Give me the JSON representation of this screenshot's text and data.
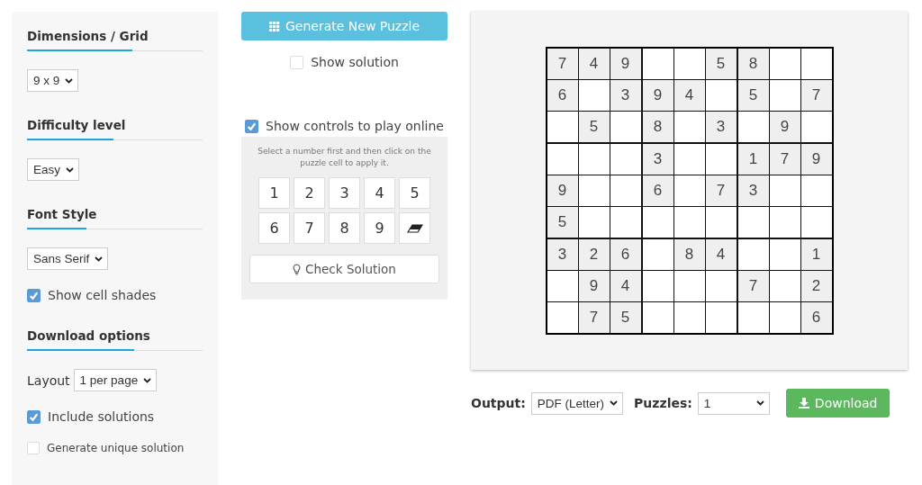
{
  "sidebar": {
    "sections": [
      {
        "title": "Dimensions / Grid",
        "controls": [
          {
            "kind": "select",
            "value": "9 x 9"
          }
        ]
      },
      {
        "title": "Difficulty level",
        "controls": [
          {
            "kind": "select",
            "value": "Easy"
          }
        ]
      },
      {
        "title": "Font Style",
        "controls": [
          {
            "kind": "select",
            "value": "Sans Serif"
          },
          {
            "kind": "checkbox",
            "label": "Show cell shades",
            "checked": true
          }
        ]
      },
      {
        "title": "Download options",
        "controls": [
          {
            "kind": "labeled-select",
            "label": "Layout",
            "value": "1 per page"
          },
          {
            "kind": "checkbox",
            "label": "Include solutions",
            "checked": true
          },
          {
            "kind": "small-checkbox",
            "label": "Generate unique solution",
            "checked": false
          }
        ]
      }
    ]
  },
  "generate_button": "Generate New Puzzle",
  "show_solution": {
    "label": "Show solution",
    "checked": false
  },
  "show_controls": {
    "label": "Show controls to play online",
    "checked": true
  },
  "controls_panel": {
    "hint": "Select a number first and then click on the puzzle cell to apply it.",
    "keys": [
      "1",
      "2",
      "3",
      "4",
      "5",
      "6",
      "7",
      "8",
      "9"
    ],
    "check_button": "Check Solution"
  },
  "puzzle": {
    "rows": [
      [
        "7",
        "4",
        "9",
        null,
        null,
        "5",
        "8",
        null,
        null
      ],
      [
        "6",
        null,
        "3",
        "9",
        "4",
        null,
        "5",
        null,
        "7"
      ],
      [
        null,
        "5",
        null,
        "8",
        null,
        "3",
        null,
        "9",
        null
      ],
      [
        null,
        null,
        null,
        "3",
        null,
        null,
        "1",
        "7",
        "9"
      ],
      [
        "9",
        null,
        null,
        "6",
        null,
        "7",
        "3",
        null,
        null
      ],
      [
        "5",
        null,
        null,
        null,
        null,
        null,
        null,
        null,
        null
      ],
      [
        "3",
        "2",
        "6",
        null,
        "8",
        "4",
        null,
        null,
        "1"
      ],
      [
        null,
        "9",
        "4",
        null,
        null,
        null,
        "7",
        null,
        "2"
      ],
      [
        null,
        "7",
        "5",
        null,
        null,
        null,
        null,
        null,
        "6"
      ]
    ]
  },
  "output": {
    "label": "Output:",
    "value": "PDF (Letter)"
  },
  "puzzles": {
    "label": "Puzzles:",
    "value": "1"
  },
  "download_button": "Download"
}
